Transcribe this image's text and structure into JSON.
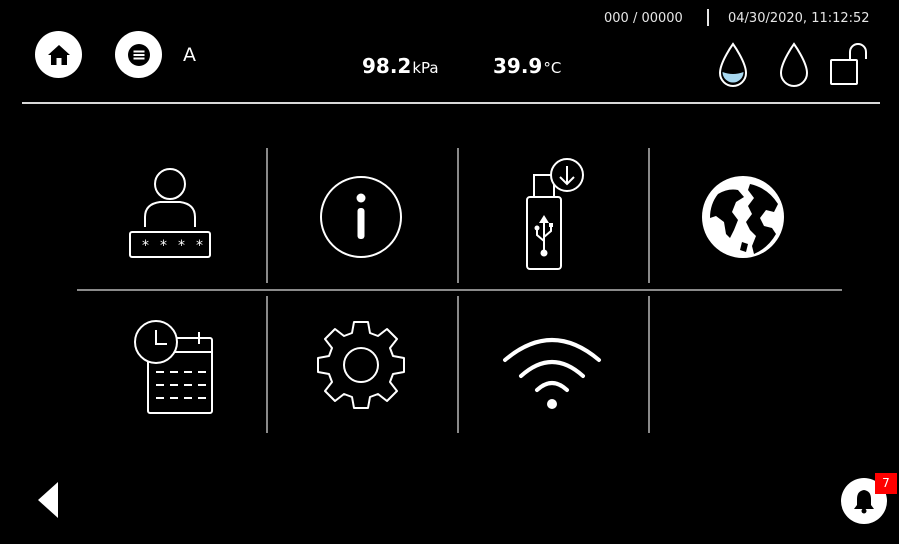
{
  "status_bar": {
    "counter": "000 / 00000",
    "datetime": "04/30/2020, 11:12:52"
  },
  "header": {
    "user_label": "A",
    "pressure_value": "98.2",
    "pressure_unit": "kPa",
    "temperature_value": "39.9",
    "temperature_unit": "°C",
    "water_level_icon": "water-drop-filled-icon",
    "water_empty_icon": "water-drop-outline-icon",
    "lock_icon": "unlock-icon"
  },
  "tiles": [
    {
      "id": "user-login",
      "icon": "user-password-icon"
    },
    {
      "id": "info",
      "icon": "info-icon"
    },
    {
      "id": "usb-export",
      "icon": "usb-download-icon"
    },
    {
      "id": "language",
      "icon": "globe-icon"
    },
    {
      "id": "date-time",
      "icon": "calendar-clock-icon"
    },
    {
      "id": "settings",
      "icon": "gear-icon"
    },
    {
      "id": "wifi",
      "icon": "wifi-icon"
    }
  ],
  "notifications": {
    "badge_count": "7"
  },
  "colors": {
    "background": "#000000",
    "foreground": "#ffffff",
    "accent_water": "#a8d8f0",
    "badge": "#ff0000"
  }
}
